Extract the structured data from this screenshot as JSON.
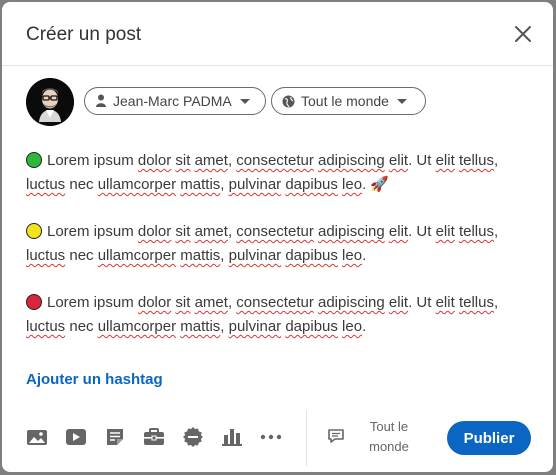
{
  "dialog": {
    "title": "Créer un post",
    "close_icon": "close-icon"
  },
  "author": {
    "name": "Jean-Marc PADMA",
    "visibility": "Tout le monde",
    "avatar_icon": "person-with-glasses-avatar"
  },
  "post": {
    "paragraphs": [
      {
        "dot_color": "#2db83d",
        "dot_name": "green-circle-emoji",
        "words": [
          "Lorem ipsum ",
          "dolor",
          " ",
          "sit",
          " ",
          "amet",
          ", ",
          "consectetur",
          " ",
          "adipiscing",
          " ",
          "elit",
          ". Ut ",
          "elit",
          " ",
          "tellus",
          ", ",
          "luctus",
          " nec ",
          "ullamcorper",
          " ",
          "mattis",
          ", ",
          "pulvinar",
          " ",
          "dapibus",
          " ",
          "leo",
          ". "
        ],
        "trailing": "🚀"
      },
      {
        "dot_color": "#f5e21f",
        "dot_name": "yellow-circle-emoji",
        "words": [
          "Lorem ipsum ",
          "dolor",
          " ",
          "sit",
          " ",
          "amet",
          ", ",
          "consectetur",
          " ",
          "adipiscing",
          " ",
          "elit",
          ". Ut ",
          "elit",
          " ",
          "tellus",
          ", ",
          "luctus",
          " nec ",
          "ullamcorper",
          " ",
          "mattis",
          ", ",
          "pulvinar",
          " ",
          "dapibus",
          " ",
          "leo",
          "."
        ],
        "trailing": ""
      },
      {
        "dot_color": "#d8263a",
        "dot_name": "red-circle-emoji",
        "words": [
          "Lorem ipsum ",
          "dolor",
          " ",
          "sit",
          " ",
          "amet",
          ", ",
          "consectetur",
          " ",
          "adipiscing",
          " ",
          "elit",
          ". Ut ",
          "elit",
          " ",
          "tellus",
          ", ",
          "luctus",
          " nec ",
          "ullamcorper",
          " ",
          "mattis",
          ", ",
          "pulvinar",
          " ",
          "dapibus",
          " ",
          "leo",
          "."
        ],
        "trailing": ""
      }
    ]
  },
  "hashtag_label": "Ajouter un hashtag",
  "toolbar": {
    "tools": [
      "image-icon",
      "video-icon",
      "document-icon",
      "job-briefcase-icon",
      "celebrate-badge-icon",
      "poll-chart-icon",
      "more-icon"
    ]
  },
  "footer": {
    "audience_line1": "Tout le",
    "audience_line2": "monde",
    "publish_label": "Publier"
  },
  "colors": {
    "accent": "#0a66c2"
  }
}
